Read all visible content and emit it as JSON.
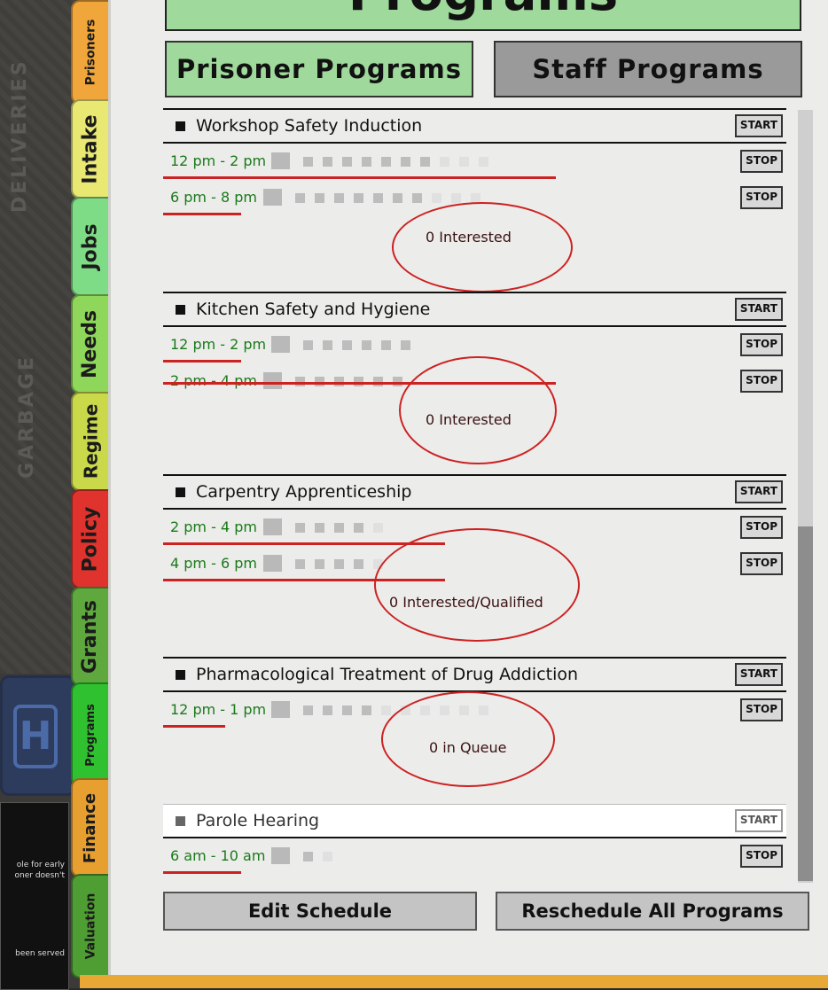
{
  "window": {
    "title": "Programs"
  },
  "top_tabs": {
    "prisoner": "Prisoner Programs",
    "staff": "Staff Programs"
  },
  "side_tabs": [
    {
      "label": "Prisoners",
      "color": "#f0a63a"
    },
    {
      "label": "Intake",
      "color": "#e9e873"
    },
    {
      "label": "Jobs",
      "color": "#7fdc86"
    },
    {
      "label": "Needs",
      "color": "#8fd75a"
    },
    {
      "label": "Regime",
      "color": "#c9d94a"
    },
    {
      "label": "Policy",
      "color": "#e0332d"
    },
    {
      "label": "Grants",
      "color": "#5fa83e"
    },
    {
      "label": "Programs",
      "color": "#2fc12f"
    },
    {
      "label": "Finance",
      "color": "#e7a02f"
    },
    {
      "label": "Valuation",
      "color": "#4f9e33"
    }
  ],
  "background": {
    "map_text_1": "GARBAGE",
    "map_text_2": "DELIVERIES",
    "message_lines": [
      "ole for early",
      "oner doesn't",
      "been served"
    ]
  },
  "programs": [
    {
      "name": "Workshop Safety Induction",
      "start_label": "START",
      "sessions": [
        {
          "time": "12 pm - 2 pm",
          "stop_label": "STOP"
        },
        {
          "time": "6 pm - 8 pm",
          "stop_label": "STOP"
        }
      ],
      "status": "0 Interested"
    },
    {
      "name": "Kitchen Safety and Hygiene",
      "start_label": "START",
      "sessions": [
        {
          "time": "12 pm - 2 pm",
          "stop_label": "STOP"
        },
        {
          "time": "2 pm - 4 pm",
          "stop_label": "STOP"
        }
      ],
      "status": "0 Interested"
    },
    {
      "name": "Carpentry Apprenticeship",
      "start_label": "START",
      "sessions": [
        {
          "time": "2 pm - 4 pm",
          "stop_label": "STOP"
        },
        {
          "time": "4 pm - 6 pm",
          "stop_label": "STOP"
        }
      ],
      "status": "0 Interested/Qualified"
    },
    {
      "name": "Pharmacological Treatment of Drug Addiction",
      "start_label": "START",
      "sessions": [
        {
          "time": "12 pm - 1 pm",
          "stop_label": "STOP"
        }
      ],
      "status": "0 in Queue"
    },
    {
      "name": "Parole Hearing",
      "start_label": "START",
      "sessions": [
        {
          "time": "6 am - 10 am",
          "stop_label": "STOP"
        }
      ],
      "status": ""
    }
  ],
  "footer": {
    "edit": "Edit Schedule",
    "reschedule": "Reschedule All Programs"
  },
  "colors": {
    "panel": "#ececea",
    "title_bg": "#9fd99b",
    "active_tab": "#9fd99b",
    "inactive_tab": "#9a9a9a",
    "time_text": "#1a7a1a",
    "annotation": "#cc2222"
  }
}
